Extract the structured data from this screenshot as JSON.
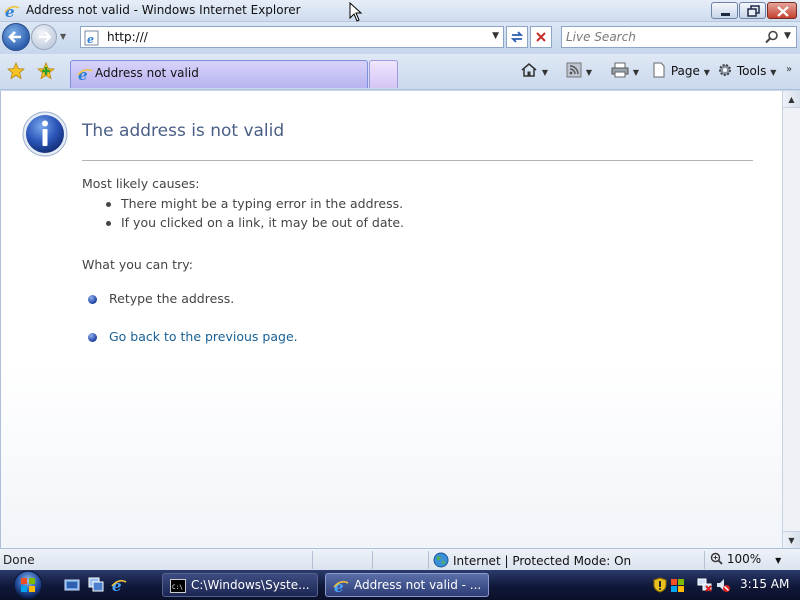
{
  "window": {
    "title": "Address not valid - Windows Internet Explorer"
  },
  "address_bar": {
    "url": "http:///",
    "search_placeholder": "Live Search"
  },
  "tabs": [
    {
      "label": "Address not valid",
      "active": true
    }
  ],
  "command_bar": {
    "page_label": "Page",
    "tools_label": "Tools"
  },
  "content": {
    "heading": "The address is not valid",
    "causes_title": "Most likely causes:",
    "causes": [
      "There might be a typing error in the address.",
      "If you clicked on a link, it may be out of date."
    ],
    "try_title": "What you can try:",
    "tries": [
      "Retype the address.",
      "Go back to the previous page."
    ]
  },
  "status_bar": {
    "status": "Done",
    "zone": "Internet | Protected Mode: On",
    "zoom": "100%"
  },
  "taskbar": {
    "tasks": [
      {
        "label": "C:\\Windows\\Syste..."
      },
      {
        "label": "Address not valid - ..."
      }
    ],
    "clock": "3:15 AM"
  },
  "colors": {
    "heading": "#4a5e86",
    "link": "#1a6196",
    "tab_active": "#b6b3f0",
    "taskbar": "#0f1838"
  }
}
